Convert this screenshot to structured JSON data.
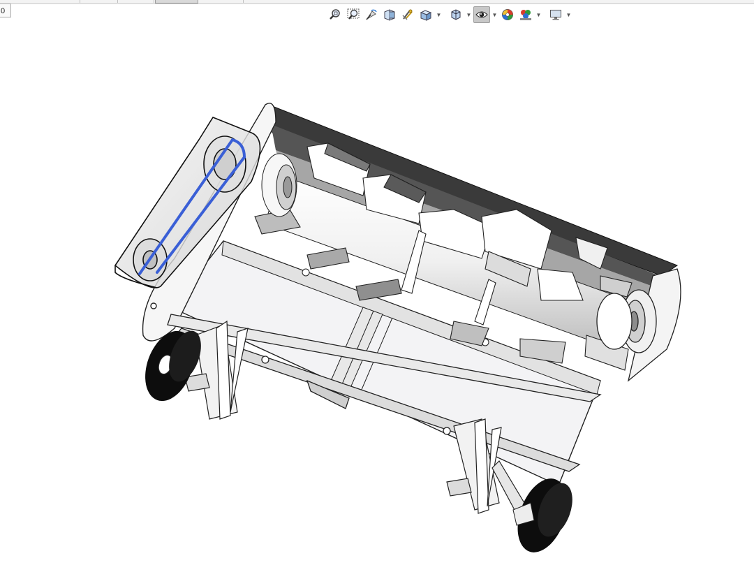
{
  "window": {
    "corner_field_value": "0"
  },
  "toolbar": {
    "buttons": [
      {
        "id": "zoom-to-fit",
        "icon": "zoom-to-fit-icon",
        "dropdown": false,
        "pressed": false
      },
      {
        "id": "zoom-to-area",
        "icon": "zoom-to-area-icon",
        "dropdown": false,
        "pressed": false
      },
      {
        "id": "previous-view",
        "icon": "previous-view-icon",
        "dropdown": false,
        "pressed": false
      },
      {
        "id": "section-view",
        "icon": "section-view-icon",
        "dropdown": false,
        "pressed": false
      },
      {
        "id": "dynamic-annotation",
        "icon": "dynamic-annotation-icon",
        "dropdown": false,
        "pressed": false
      },
      {
        "id": "view-orientation",
        "icon": "view-orientation-icon",
        "dropdown": true,
        "pressed": false
      },
      {
        "id": "display-style",
        "icon": "display-style-icon",
        "dropdown": true,
        "pressed": false
      },
      {
        "id": "hide-show-items",
        "icon": "eye-icon",
        "dropdown": true,
        "pressed": true
      },
      {
        "id": "edit-appearance",
        "icon": "appearance-icon",
        "dropdown": false,
        "pressed": false
      },
      {
        "id": "apply-scene",
        "icon": "scene-icon",
        "dropdown": true,
        "pressed": false
      },
      {
        "id": "view-settings",
        "icon": "monitor-icon",
        "dropdown": true,
        "pressed": false
      }
    ]
  },
  "colors": {
    "belt": "#3a5fd6",
    "frame_line": "#222222",
    "dark_panel": "#3a3a3a",
    "tire": "#0d0d0d",
    "toolbar_pressed": "#c8c8c8"
  },
  "viewport": {
    "model": "rotary-tiller-assembly"
  }
}
